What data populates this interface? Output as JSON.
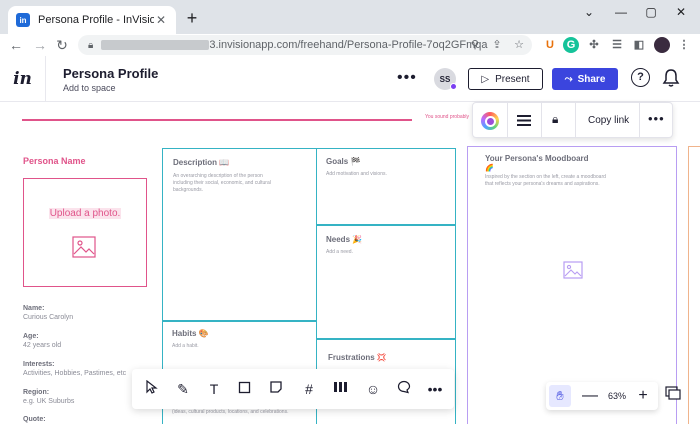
{
  "browser": {
    "tab_title": "Persona Profile - InVision",
    "tab_close": "✕",
    "new_tab": "+",
    "window_min": "⌄",
    "window_minimize": "—",
    "window_restore": "▢",
    "window_close": "✕",
    "url_visible": "3.invisionapp.com/freehand/Persona-Profile-7oq2GFmqa"
  },
  "header": {
    "logo": "in",
    "doc_title": "Persona Profile",
    "doc_subtitle": "Add to space",
    "more": "•••",
    "avatar_initials": "SS",
    "present_label": "Present",
    "share_label": "Share",
    "help": "?"
  },
  "canvas": {
    "tiny_banner": "You sound probably",
    "persona": {
      "title": "Persona Name",
      "upload_label": "Upload a photo.",
      "fields": [
        {
          "label": "Name:",
          "value": "Curious Carolyn"
        },
        {
          "label": "Age:",
          "value": "42 years old"
        },
        {
          "label": "Interests:",
          "value": "Activities, Hobbies, Pastimes, etc"
        },
        {
          "label": "Region:",
          "value": "e.g. UK Suburbs"
        },
        {
          "label": "Quote:",
          "value": ""
        }
      ]
    },
    "description": {
      "title": "Description 📖",
      "text": "An overarching description of the person including their social, economic, and cultural backgrounds."
    },
    "goals": {
      "title": "Goals 🏁",
      "text": "Add motivation and visions."
    },
    "needs": {
      "title": "Needs 🎉",
      "text": "Add a need."
    },
    "habits": {
      "title": "Habits 🎨",
      "text": "Add a habit."
    },
    "frustrations": {
      "title": "Frustrations 💢"
    },
    "bottom_text": "(ideas, cultural products, locations, and celebrations.",
    "moodboard": {
      "title": "Your Persona's Moodboard",
      "emoji": "🌈",
      "text": "Inspired by the section on the left, create a moodboard that reflects your persona's dreams and aspirations."
    }
  },
  "selection_toolbar": {
    "copy_link": "Copy link",
    "more": "•••",
    "selected_color": "#9d4ed8"
  },
  "bottom_toolbar": {
    "more": "•••"
  },
  "zoom": {
    "value": "63%",
    "minus": "—",
    "plus": "+"
  },
  "colors": {
    "accent": "#3b45de",
    "persona_pink": "#e0548a",
    "teal": "#35b3c4",
    "purple": "#b89df2"
  }
}
